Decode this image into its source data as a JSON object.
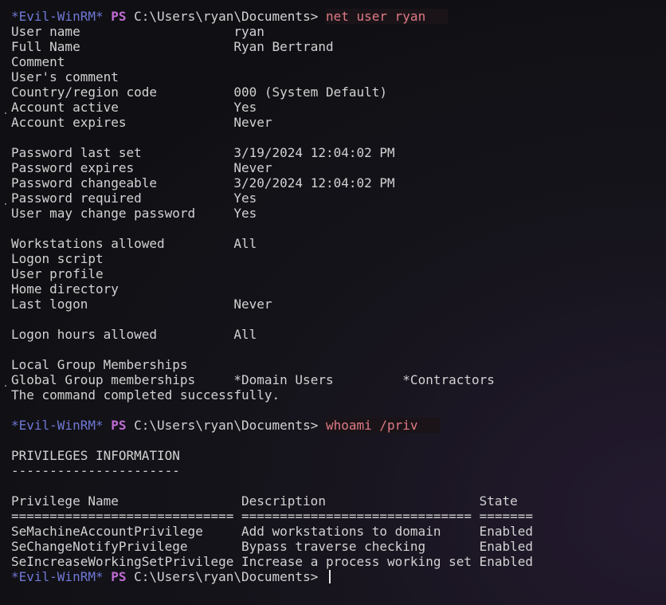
{
  "prompt": {
    "label": "*Evil-WinRM*",
    "ps": "PS",
    "path": "C:\\Users\\ryan\\Documents>"
  },
  "commands": {
    "net_user": "net user ryan",
    "whoami": "whoami /priv"
  },
  "user_info": [
    {
      "field": "User name",
      "value": "ryan"
    },
    {
      "field": "Full Name",
      "value": "Ryan Bertrand"
    },
    {
      "field": "Comment",
      "value": ""
    },
    {
      "field": "User's comment",
      "value": ""
    },
    {
      "field": "Country/region code",
      "value": "000 (System Default)"
    },
    {
      "field": "Account active",
      "value": "Yes"
    },
    {
      "field": "Account expires",
      "value": "Never"
    },
    {
      "field": "Password last set",
      "value": "3/19/2024 12:04:02 PM"
    },
    {
      "field": "Password expires",
      "value": "Never"
    },
    {
      "field": "Password changeable",
      "value": "3/20/2024 12:04:02 PM"
    },
    {
      "field": "Password required",
      "value": "Yes"
    },
    {
      "field": "User may change password",
      "value": "Yes"
    },
    {
      "field": "Workstations allowed",
      "value": "All"
    },
    {
      "field": "Logon script",
      "value": ""
    },
    {
      "field": "User profile",
      "value": ""
    },
    {
      "field": "Home directory",
      "value": ""
    },
    {
      "field": "Last logon",
      "value": "Never"
    },
    {
      "field": "Logon hours allowed",
      "value": "All"
    },
    {
      "field": "Local Group Memberships",
      "value": ""
    },
    {
      "field": "Global Group memberships",
      "value": "*Domain Users",
      "value2": "*Contractors"
    }
  ],
  "command_completed": "The command completed successfully.",
  "privileges": {
    "title": "PRIVILEGES INFORMATION",
    "title_underline": "----------------------",
    "headers": [
      "Privilege Name",
      "Description",
      "State"
    ],
    "separators": [
      "=============================",
      "==============================",
      "======="
    ],
    "rows": [
      {
        "name": "SeMachineAccountPrivilege",
        "description": "Add workstations to domain",
        "state": "Enabled"
      },
      {
        "name": "SeChangeNotifyPrivilege",
        "description": "Bypass traverse checking",
        "state": "Enabled"
      },
      {
        "name": "SeIncreaseWorkingSetPrivilege",
        "description": "Increase a process working set",
        "state": "Enabled"
      }
    ]
  }
}
